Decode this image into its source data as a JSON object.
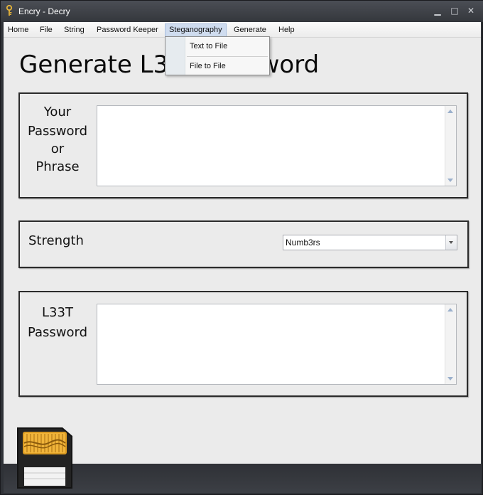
{
  "window": {
    "title": "Encry - Decry",
    "controls": {
      "minimize": "▁",
      "maximize": "□",
      "close": "✕"
    }
  },
  "menu": {
    "items": [
      "Home",
      "File",
      "String",
      "Password Keeper",
      "Steganography",
      "Generate",
      "Help"
    ],
    "active": "Steganography"
  },
  "dropdown": {
    "items": [
      "Text to File",
      "File to File"
    ]
  },
  "page": {
    "title": "Generate L33T Password"
  },
  "input_group": {
    "label_lines": [
      "Your",
      "Password",
      "or",
      "Phrase"
    ],
    "value": ""
  },
  "strength_group": {
    "label": "Strength",
    "selected": "Numb3rs"
  },
  "output_group": {
    "label_lines": [
      "L33T",
      "Password"
    ],
    "value": ""
  },
  "icons": {
    "app": "key-icon",
    "logo": "sd-card-icon"
  },
  "colors": {
    "titlebar": "#34373c",
    "client": "#ebebeb",
    "active_menu": "#cfdcef",
    "scroll_arrow": "#9bb0cc"
  }
}
